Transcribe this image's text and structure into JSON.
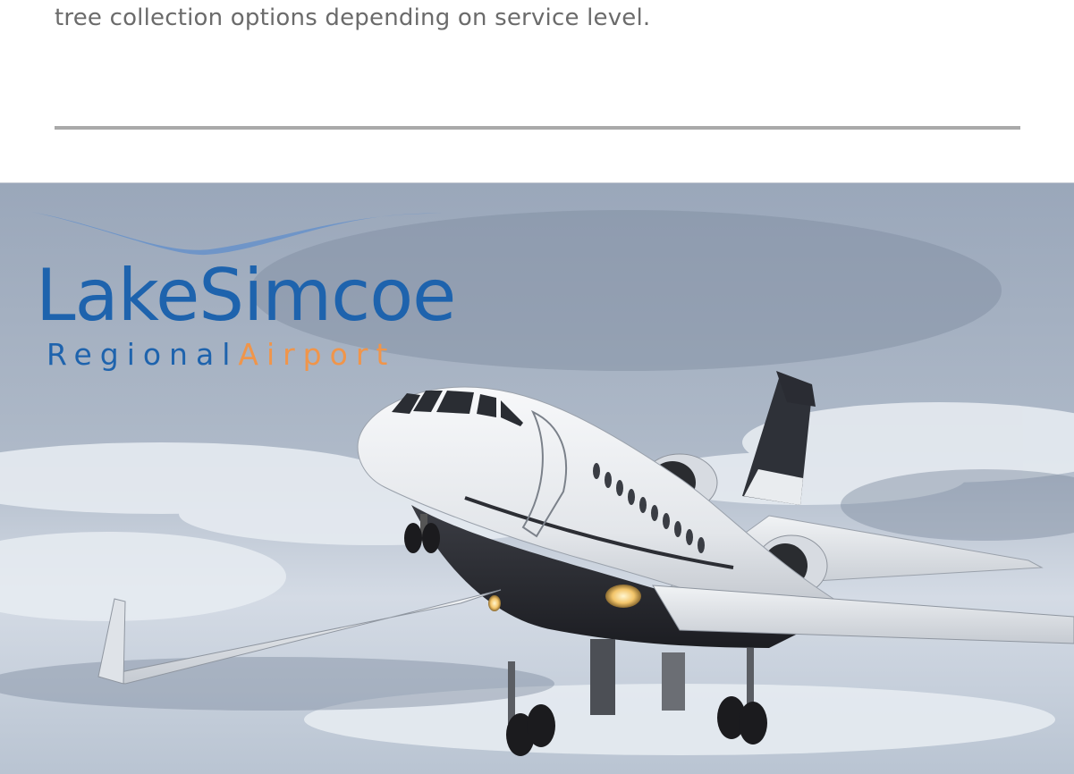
{
  "intro": {
    "text": "tree collection options depending on service level."
  },
  "hero": {
    "logo": {
      "title": "LakeSimcoe",
      "subtitle_regional": "Regional",
      "subtitle_airport": "Airport"
    },
    "colors": {
      "brand_blue": "#1e63ad",
      "brand_orange": "#f0954a",
      "sky_top": "#8f9db2",
      "sky_mid": "#c9d3e0"
    },
    "photo": "business-jet-in-flight"
  }
}
